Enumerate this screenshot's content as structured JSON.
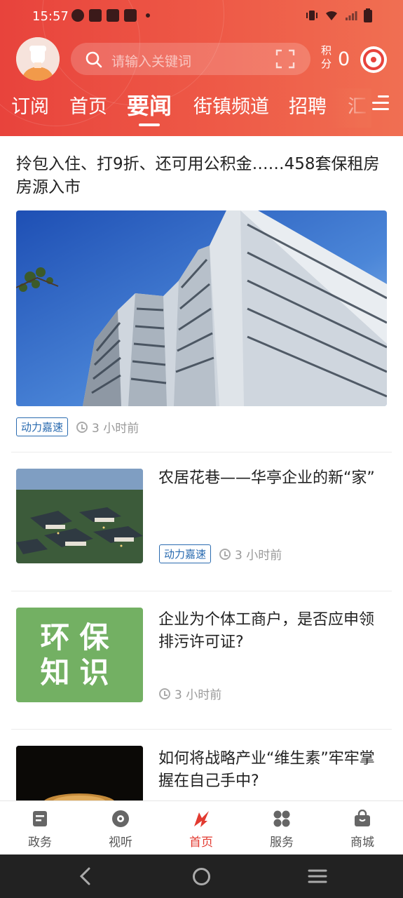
{
  "status_bar": {
    "time": "15:57"
  },
  "search": {
    "placeholder": "请输入关键词"
  },
  "points": {
    "label": "积分",
    "value": "0"
  },
  "tabs": [
    {
      "label": "订阅"
    },
    {
      "label": "首页"
    },
    {
      "label": "要闻",
      "active": true
    },
    {
      "label": "街镇频道"
    },
    {
      "label": "招聘"
    },
    {
      "label": "汇"
    }
  ],
  "feed": {
    "featured": {
      "title": "拎包入住、打9折、还可用公积金……458套保租房房源入市",
      "tag": "动力嘉速",
      "time": "3 小时前"
    },
    "items": [
      {
        "title": "农居花巷——华亭企业的新“家”",
        "tag": "动力嘉速",
        "time": "3 小时前"
      },
      {
        "title": "企业为个体工商户，是否应申领排污许可证?",
        "thumb_text": "环保知识",
        "time": "3 小时前"
      },
      {
        "title": "如何将战略产业“维生素”牢牢掌握在自己手中?"
      }
    ]
  },
  "bottom_nav": [
    {
      "label": "政务",
      "icon": "document-icon"
    },
    {
      "label": "视听",
      "icon": "disc-icon"
    },
    {
      "label": "首页",
      "icon": "home-logo-icon",
      "active": true
    },
    {
      "label": "服务",
      "icon": "grid-icon"
    },
    {
      "label": "商城",
      "icon": "shopping-bag-icon"
    }
  ],
  "colors": {
    "header": "#e8433c",
    "accent": "#e23a30",
    "tag": "#2a6bb0"
  }
}
